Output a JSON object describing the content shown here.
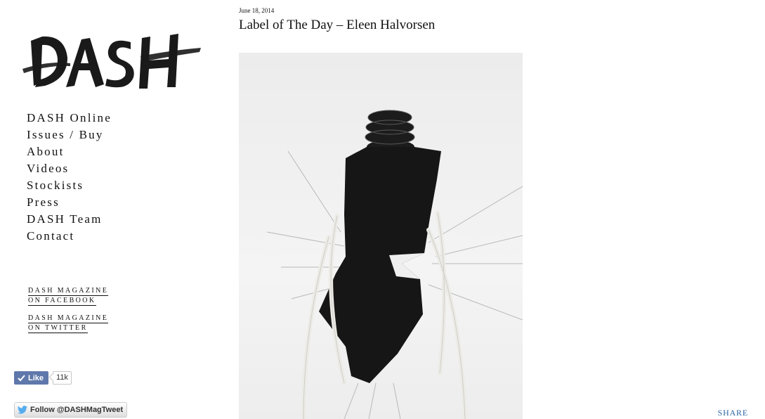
{
  "logo": {
    "text": "DASH"
  },
  "nav": {
    "items": [
      {
        "label": "DASH Online"
      },
      {
        "label": "Issues / Buy"
      },
      {
        "label": "About"
      },
      {
        "label": "Videos"
      },
      {
        "label": "Stockists"
      },
      {
        "label": "Press"
      },
      {
        "label": "DASH Team"
      },
      {
        "label": "Contact"
      }
    ]
  },
  "social": {
    "facebook": {
      "line1": "DASH MAGAZINE",
      "line2": "ON FACEBOOK"
    },
    "twitter": {
      "line1": "DASH MAGAZINE",
      "line2": "ON TWITTER"
    },
    "like_label": "Like",
    "like_count": "11k",
    "follow_label": "Follow @DASHMagTweet"
  },
  "post": {
    "date": "June 18, 2014",
    "title": "Label of The Day – Eleen Halvorsen"
  },
  "share_label": "SHARE",
  "colors": {
    "facebook_blue": "#5f78ab",
    "share_link": "#2c66a6",
    "twitter_blue": "#55acee"
  }
}
